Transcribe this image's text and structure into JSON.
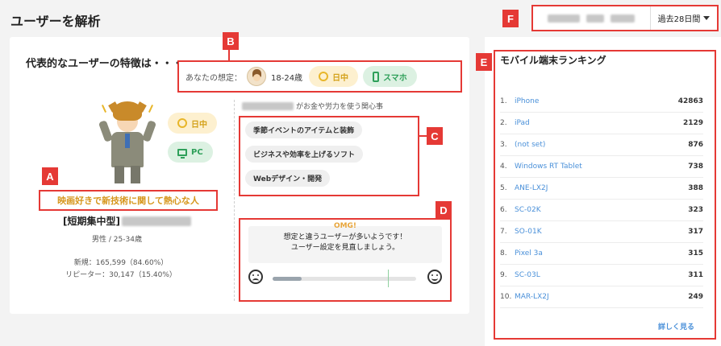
{
  "page": {
    "title": "ユーザーを解析"
  },
  "date_range": {
    "selected": "過去28日間"
  },
  "badges": {
    "a": "A",
    "b": "B",
    "c": "C",
    "d": "D",
    "e": "E",
    "f": "F"
  },
  "main": {
    "heading": "代表的なユーザーの特徴は・・・",
    "assumption": {
      "label": "あなたの想定：",
      "age": "18-24歳",
      "time": "日中",
      "device": "スマホ"
    },
    "persona": {
      "time": "日中",
      "device": "PC",
      "tagline": "映画好きで新技術に関して熱心な人",
      "type_label": "[短期集中型]",
      "gender_age": "男性 / 25-34歳",
      "new_users": "新規：165,599（84.60%）",
      "returning_users": "リピーター：30,147（15.40%）"
    },
    "interests": {
      "title_suffix": "がお金や労力を使う関心事",
      "items": [
        "季節イベントのアイテムと装飾",
        "ビジネスや効率を上げるソフト",
        "Webデザイン・開発"
      ]
    },
    "feedback": {
      "exclaim": "OMG!",
      "line1": "想定と違うユーザーが多いようです！",
      "line2": "ユーザー設定を見直しましょう。",
      "match_level": 0.2
    }
  },
  "ranking": {
    "title": "モバイル端末ランキング",
    "items": [
      {
        "rank": "1.",
        "name": "iPhone",
        "value": "42863"
      },
      {
        "rank": "2.",
        "name": "iPad",
        "value": "2129"
      },
      {
        "rank": "3.",
        "name": "(not set)",
        "value": "876"
      },
      {
        "rank": "4.",
        "name": "Windows RT Tablet",
        "value": "738"
      },
      {
        "rank": "5.",
        "name": "ANE-LX2J",
        "value": "388"
      },
      {
        "rank": "6.",
        "name": "SC-02K",
        "value": "323"
      },
      {
        "rank": "7.",
        "name": "SO-01K",
        "value": "317"
      },
      {
        "rank": "8.",
        "name": "Pixel 3a",
        "value": "315"
      },
      {
        "rank": "9.",
        "name": "SC-03L",
        "value": "311"
      },
      {
        "rank": "10.",
        "name": "MAR-LX2J",
        "value": "249"
      }
    ],
    "more_link": "詳しく見る"
  },
  "colors": {
    "annotation": "#e53935",
    "accent_blue": "#4a90d9",
    "day": "#d4a21c",
    "device": "#2fa05a"
  }
}
